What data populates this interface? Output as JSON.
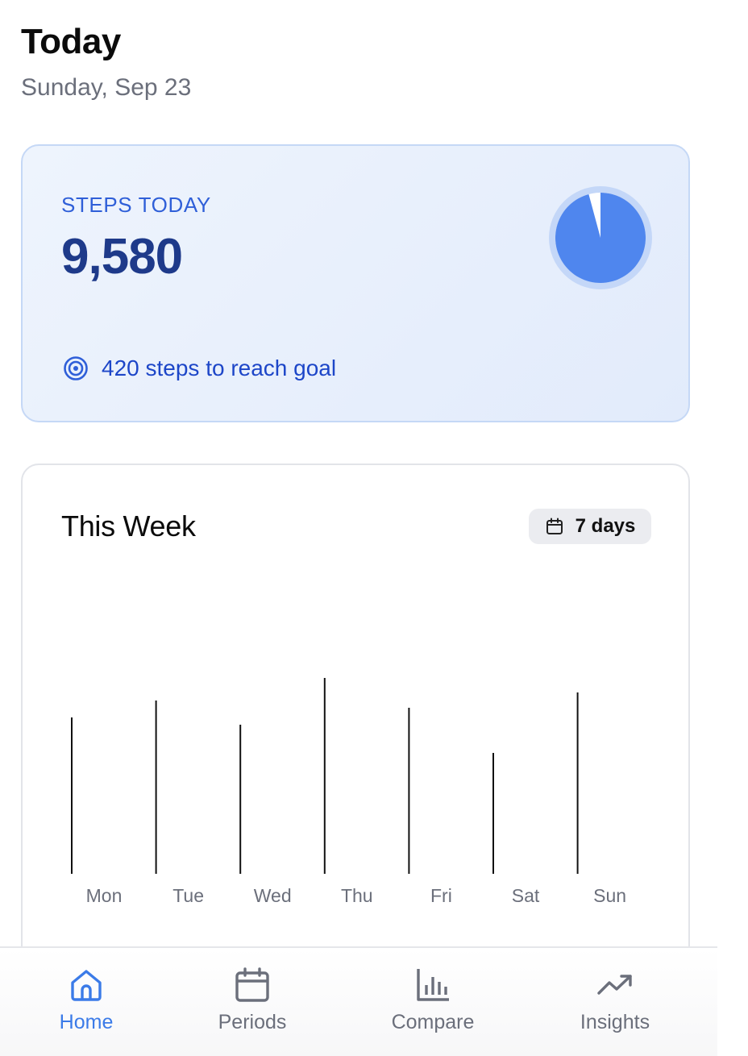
{
  "header": {
    "title": "Today",
    "date": "Sunday, Sep 23"
  },
  "steps_card": {
    "label": "STEPS TODAY",
    "value": "9,580",
    "goal_text": "420 steps to reach goal",
    "goal_icon": "target-icon",
    "progress_fraction": 0.958,
    "colors": {
      "ring": "#4f86ee",
      "ring_track": "#c4d7f8",
      "accent": "#2f5fd8"
    }
  },
  "week_card": {
    "title": "This Week",
    "chip_label": "7 days",
    "chip_icon": "calendar-icon"
  },
  "chart_data": {
    "type": "bar",
    "categories": [
      "Mon",
      "Tue",
      "Wed",
      "Thu",
      "Fri",
      "Sat",
      "Sun"
    ],
    "values": [
      194,
      215,
      185,
      243,
      206,
      150,
      225
    ],
    "title": "",
    "xlabel": "",
    "ylabel": "",
    "grid": false
  },
  "tab_bar": {
    "items": [
      {
        "label": "Home",
        "icon": "home-icon",
        "active": true
      },
      {
        "label": "Periods",
        "icon": "calendar-icon",
        "active": false
      },
      {
        "label": "Compare",
        "icon": "bar-chart-icon",
        "active": false
      },
      {
        "label": "Insights",
        "icon": "trending-up-icon",
        "active": false
      }
    ],
    "colors": {
      "active": "#3b7be8",
      "inactive": "#6b6f7b"
    }
  }
}
